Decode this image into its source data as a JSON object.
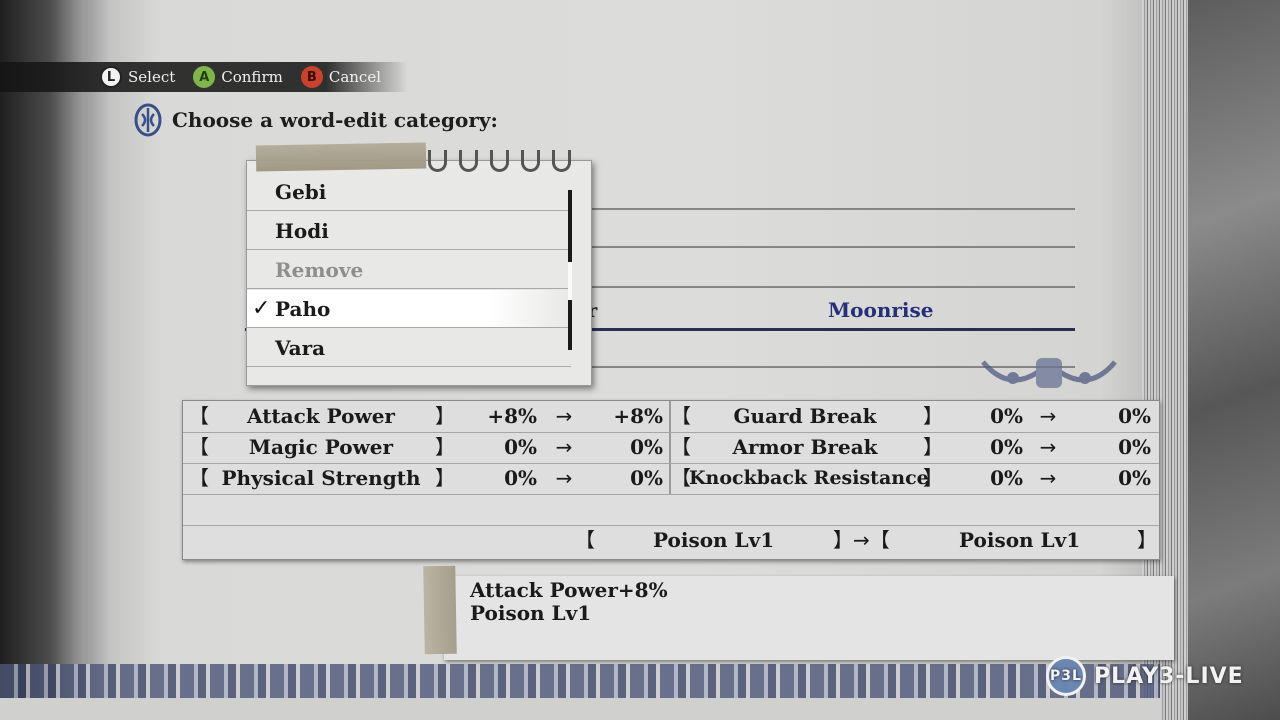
{
  "hints": [
    {
      "button": "L",
      "label": "Select"
    },
    {
      "button": "A",
      "label": "Confirm"
    },
    {
      "button": "B",
      "label": "Cancel"
    }
  ],
  "prompt": "Choose a word-edit category:",
  "background_row": {
    "left_text": "ir",
    "name": "Moonrise"
  },
  "dropdown": {
    "items": [
      {
        "label": "Gebi",
        "state": "normal"
      },
      {
        "label": "Hodi",
        "state": "normal"
      },
      {
        "label": "Remove",
        "state": "disabled"
      },
      {
        "label": "Paho",
        "state": "selected"
      },
      {
        "label": "Vara",
        "state": "normal"
      }
    ],
    "check": "✓"
  },
  "stats": {
    "rows": [
      {
        "left": {
          "name": "Attack Power",
          "from": "+8%",
          "to": "+8%"
        },
        "right": {
          "name": "Guard Break",
          "from": "0%",
          "to": "0%"
        }
      },
      {
        "left": {
          "name": "Magic Power",
          "from": "0%",
          "to": "0%"
        },
        "right": {
          "name": "Armor Break",
          "from": "0%",
          "to": "0%"
        }
      },
      {
        "left": {
          "name": "Physical Strength",
          "from": "0%",
          "to": "0%"
        },
        "right": {
          "name": "Knockback Resistance",
          "from": "0%",
          "to": "0%"
        }
      }
    ],
    "effect": {
      "from": "Poison Lv1",
      "to": "Poison Lv1"
    },
    "open_bracket": "【",
    "close_bracket": "】",
    "arrow": "→",
    "effect_arrow": "】→【"
  },
  "summary": {
    "lines": [
      "Attack Power+8%",
      "Poison Lv1"
    ]
  },
  "watermark": {
    "text": "PLAY3-LIVE",
    "logo": "P3L"
  },
  "colors": {
    "accent_blue": "#26307a",
    "button_a": "#7fb54a",
    "button_b": "#c8422e"
  }
}
